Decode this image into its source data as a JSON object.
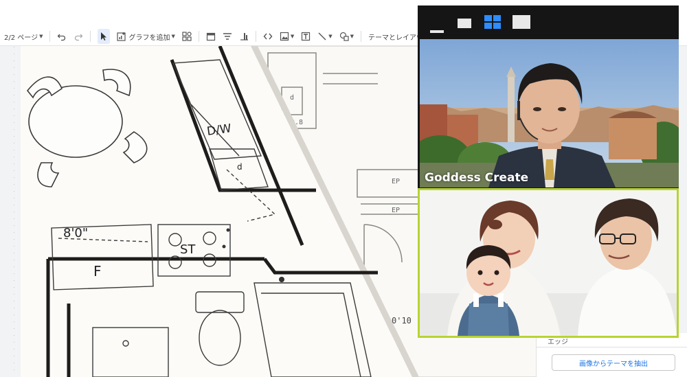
{
  "toolbar": {
    "page_indicator": "2/2 ページ",
    "add_chart_label": "グラフを追加",
    "theme_layout_label": "テーマとレイアウト"
  },
  "call": {
    "participant_name": "Goddess Create"
  },
  "side_panel": {
    "section_label": "エッジ",
    "extract_theme_button": "画像からテーマを抽出"
  },
  "colors": {
    "active_speaker_border": "#b7d332",
    "view_icon_active": "#2d8cff",
    "toolbar_accent": "#1a73e8"
  }
}
